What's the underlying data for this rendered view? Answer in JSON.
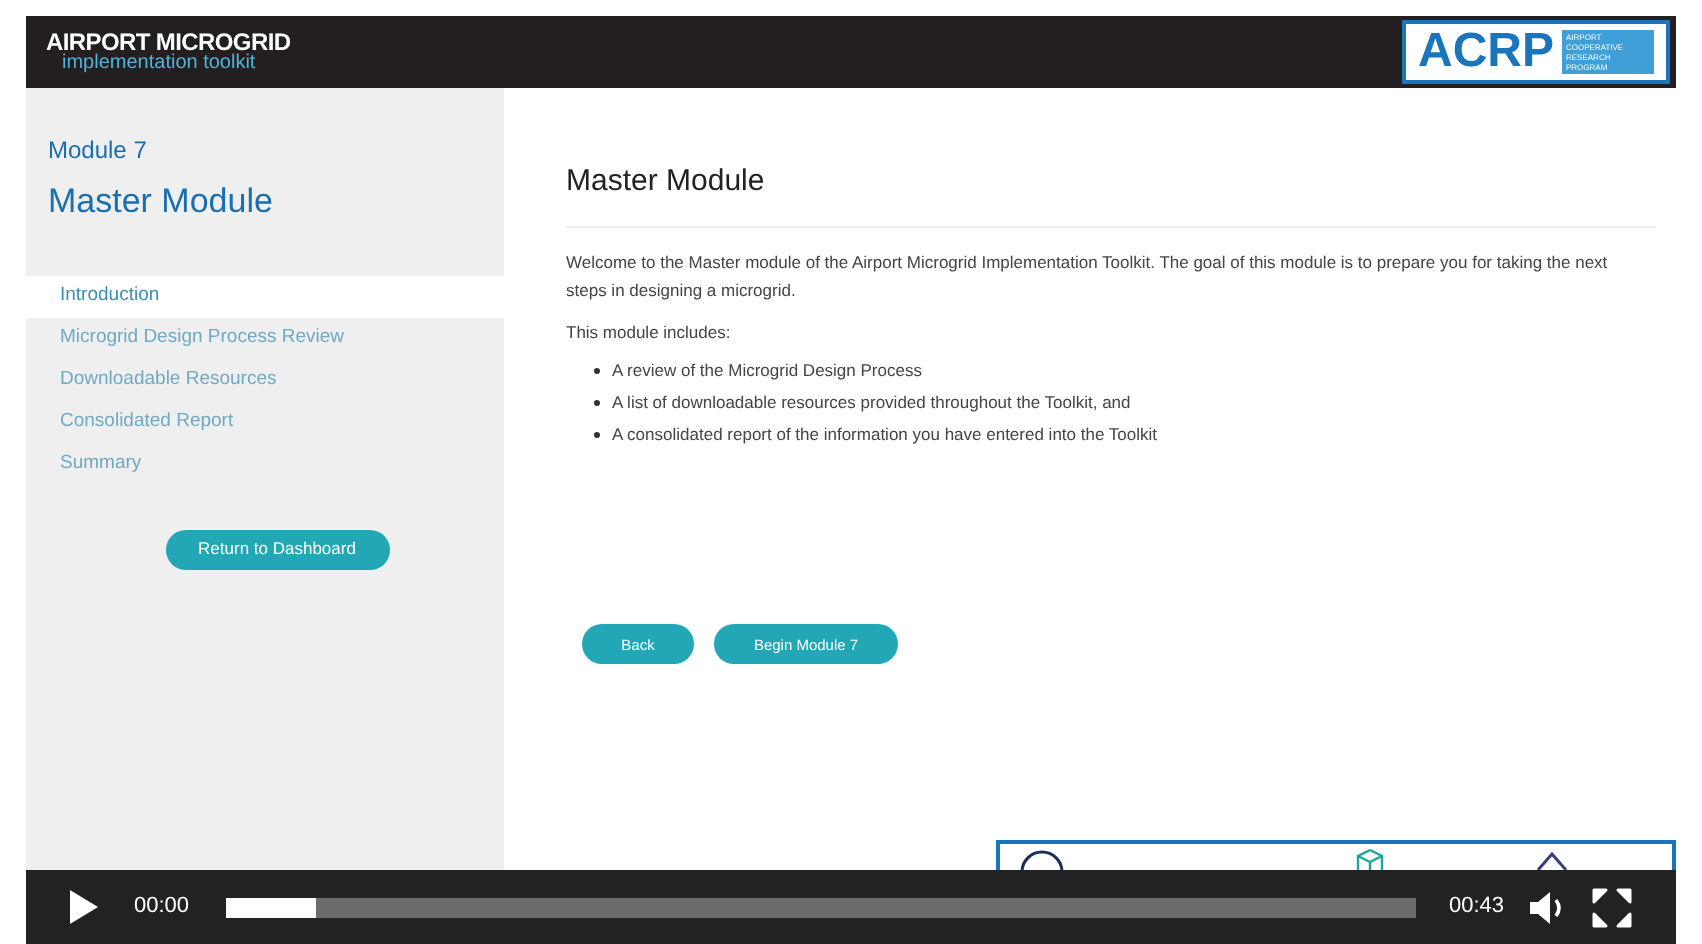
{
  "header": {
    "title": "AIRPORT MICROGRID",
    "subtitle": "implementation toolkit",
    "logo": {
      "text": "ACRP",
      "tagline": "AIRPORT COOPERATIVE RESEARCH PROGRAM"
    }
  },
  "sidebar": {
    "module_number": "Module 7",
    "module_title": "Master Module",
    "items": [
      {
        "label": "Introduction",
        "selected": true
      },
      {
        "label": "Microgrid Design Process Review",
        "selected": false
      },
      {
        "label": "Downloadable Resources",
        "selected": false
      },
      {
        "label": "Consolidated Report",
        "selected": false
      },
      {
        "label": "Summary",
        "selected": false
      }
    ],
    "button": "Return to Dashboard"
  },
  "content": {
    "title": "Master Module",
    "intro": "Welcome to the Master module of the Airport Microgrid Implementation Toolkit. The goal of this module is to prepare you for taking the next steps in designing a microgrid.",
    "includes_label": "This module includes:",
    "bullets": [
      "A review of the Microgrid Design Process",
      "A list of downloadable resources provided throughout the Toolkit, and",
      "A consolidated report of the information you have entered into the Toolkit"
    ],
    "buttons": [
      "Back",
      "Begin Module 7"
    ]
  },
  "player": {
    "current_time": "00:00",
    "duration": "00:43",
    "level": 0.077
  }
}
